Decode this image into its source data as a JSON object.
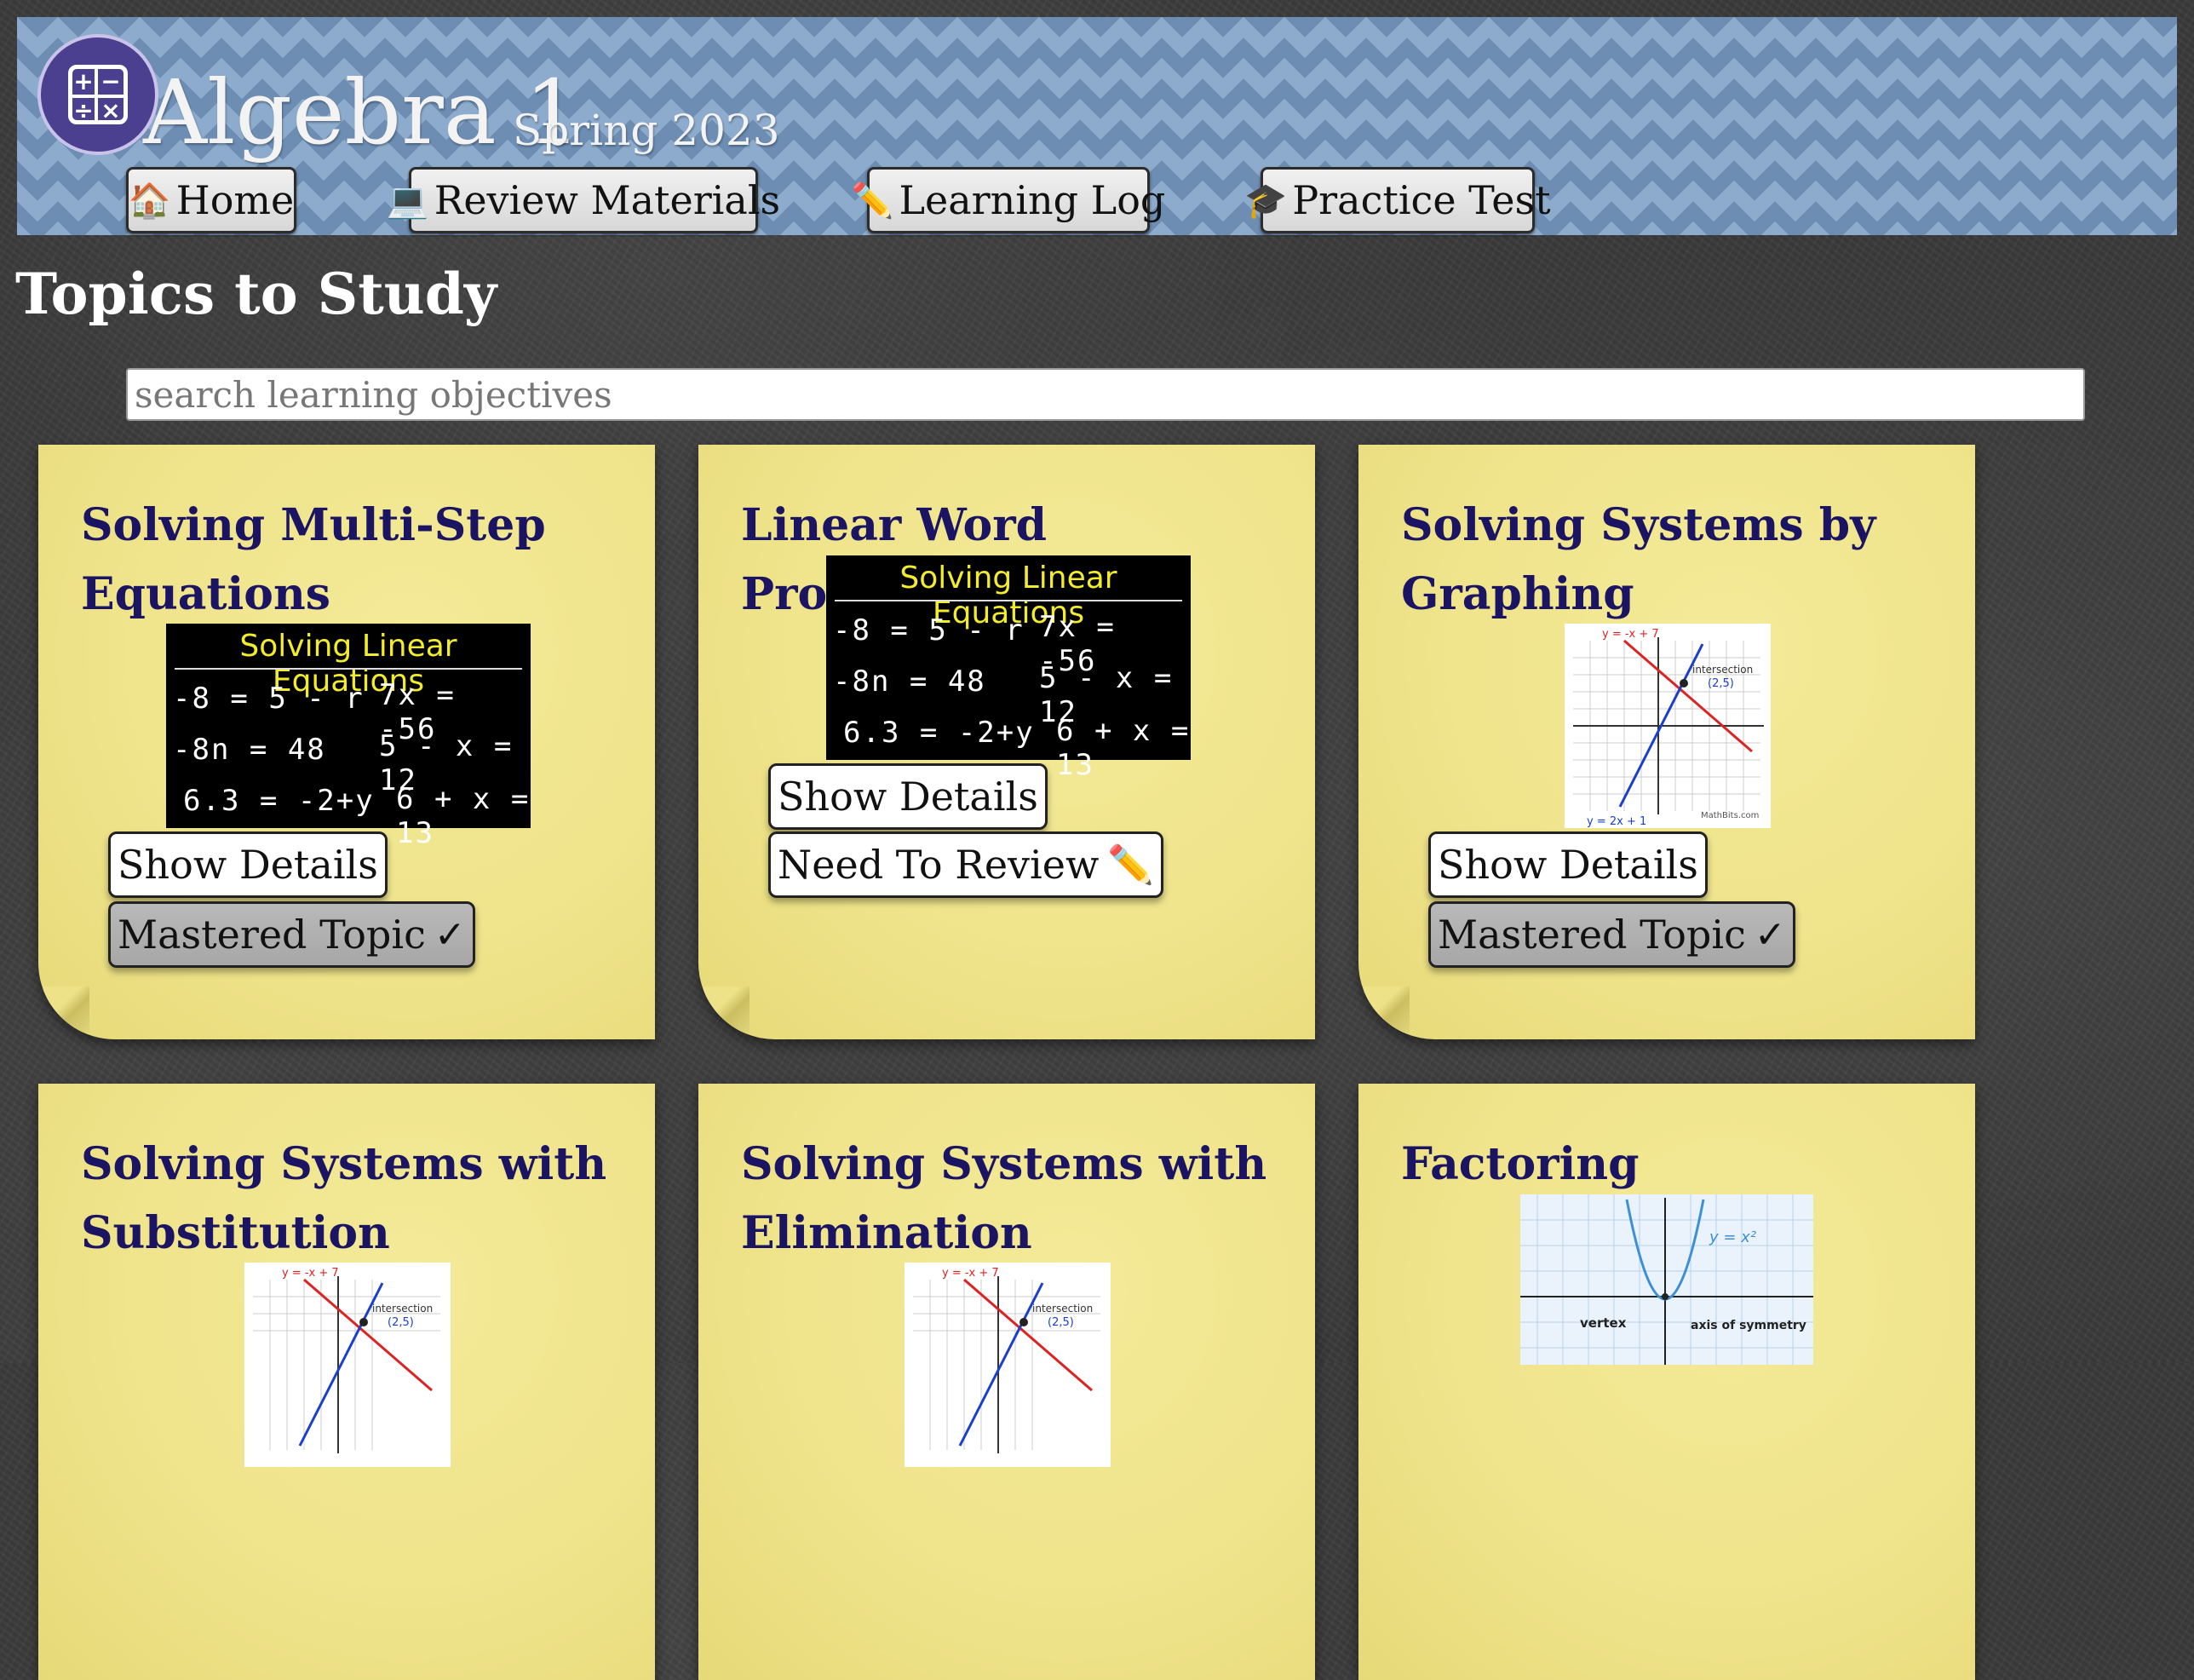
{
  "header": {
    "title": "Algebra 1",
    "subtitle": "Spring 2023",
    "logo_symbols": [
      "+",
      "−",
      "÷",
      "×"
    ]
  },
  "nav": {
    "home": {
      "icon": "🏠",
      "label": " Home"
    },
    "review": {
      "icon": "💻",
      "label": "Review Materials"
    },
    "log": {
      "icon": "✏️",
      "label": "Learning Log"
    },
    "test": {
      "icon": "🎓",
      "label": "Practice Test"
    }
  },
  "page_title": "Topics to Study",
  "search": {
    "placeholder": "search learning objectives"
  },
  "eq_image": {
    "title": "Solving Linear Equations",
    "left": [
      "-8 = 5 - r",
      "-8n = 48",
      "6.3 = -2+y"
    ],
    "right": [
      "7x = -56",
      "5 - x = 12",
      "6 + x = 13"
    ]
  },
  "graph_image": {
    "red_label": "y = -x + 7",
    "blue_label": "y = 2x + 1",
    "note": "intersection",
    "point": "(2,5)",
    "credit": "MathBits.com"
  },
  "parabola_image": {
    "eq": "y = x²",
    "vertex": "vertex",
    "axis": "axis of symmetry"
  },
  "cards": [
    {
      "title": "Solving Multi-Step Equations",
      "details": "Show Details",
      "status": "Mastered Topic",
      "status_icon": "✓"
    },
    {
      "title": "Linear Word Problems",
      "details": "Show Details",
      "status": "Need To Review",
      "status_icon": "✏️"
    },
    {
      "title": "Solving Systems by Graphing",
      "details": "Show Details",
      "status": "Mastered Topic",
      "status_icon": "✓"
    },
    {
      "title": "Solving Systems with Substitution"
    },
    {
      "title": "Solving Systems with Elimination"
    },
    {
      "title": "Factoring"
    }
  ]
}
